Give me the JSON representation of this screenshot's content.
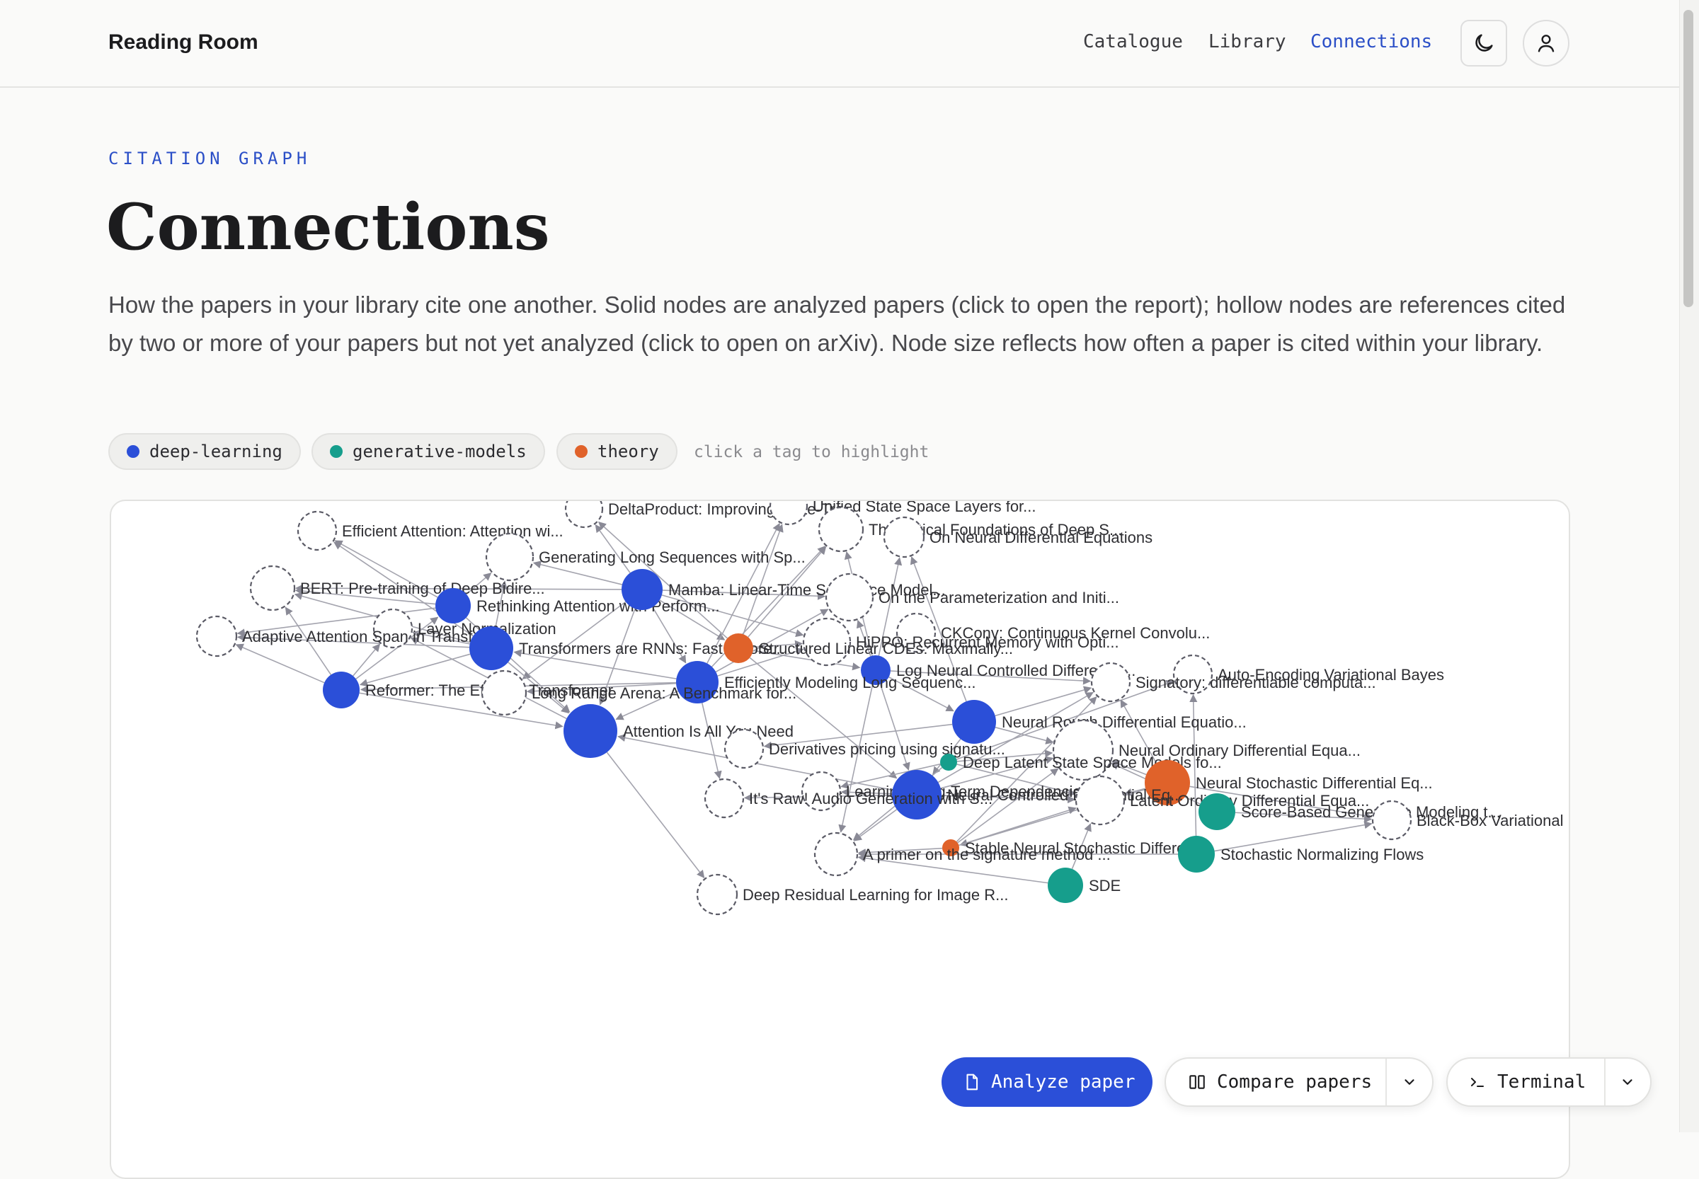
{
  "brand": "Reading Room",
  "nav": [
    {
      "label": "Catalogue",
      "active": false
    },
    {
      "label": "Library",
      "active": false
    },
    {
      "label": "Connections",
      "active": true
    }
  ],
  "header_icons": [
    "moon-icon",
    "user-icon"
  ],
  "eyebrow": "CITATION GRAPH",
  "title": "Connections",
  "description": "How the papers in your library cite one another. Solid nodes are analyzed papers (click to open the report); hollow nodes are references cited by two or more of your papers but not yet analyzed (click to open on arXiv). Node size reflects how often a paper is cited within your library.",
  "tags": [
    {
      "label": "deep-learning",
      "color": "#2b4fd8"
    },
    {
      "label": "generative-models",
      "color": "#169e8c"
    },
    {
      "label": "theory",
      "color": "#e0622a"
    }
  ],
  "tag_hint": "click a tag to highlight",
  "colors": {
    "deep-learning": "#2b4fd8",
    "generative-models": "#169e8c",
    "theory": "#e0622a",
    "accent": "#2b4fc7"
  },
  "graph": {
    "nodes": [
      {
        "id": "deltaproduct",
        "label": "DeltaProduct: Improving State-Tra...",
        "kind": "hollow"
      },
      {
        "id": "unified",
        "label": "Unified State Space Layers for...",
        "kind": "hollow"
      },
      {
        "id": "efficientattn",
        "label": "Efficient Attention: Attention wi...",
        "kind": "hollow"
      },
      {
        "id": "theofound",
        "label": "Theoretical Foundations of Deep S...",
        "kind": "hollow"
      },
      {
        "id": "neuralde",
        "label": "On Neural Differential Equations",
        "kind": "hollow"
      },
      {
        "id": "genlong",
        "label": "Generating Long Sequences with Sp...",
        "kind": "hollow"
      },
      {
        "id": "bert",
        "label": "BERT: Pre-training of Deep Bidire...",
        "kind": "hollow"
      },
      {
        "id": "rethinking",
        "label": "Rethinking Attention with Perform...",
        "kind": "deep-learning"
      },
      {
        "id": "mamba",
        "label": "Mamba: Linear-Time Sequence Model...",
        "kind": "deep-learning"
      },
      {
        "id": "param",
        "label": "On the Parameterization and Initi...",
        "kind": "hollow"
      },
      {
        "id": "layernorm",
        "label": "Layer Normalization",
        "kind": "hollow"
      },
      {
        "id": "adaptive",
        "label": "Adaptive Attention Span in Transf...",
        "kind": "hollow"
      },
      {
        "id": "ckconv",
        "label": "CKConv: Continuous Kernel Convolu...",
        "kind": "hollow"
      },
      {
        "id": "hippo",
        "label": "HiPPO: Recurrent Memory with Opti...",
        "kind": "hollow"
      },
      {
        "id": "rnns",
        "label": "Transformers are RNNs: Fast Autore...",
        "kind": "deep-learning"
      },
      {
        "id": "struct",
        "label": "Structured Linear CDEs: Maximally...",
        "kind": "theory"
      },
      {
        "id": "logncde",
        "label": "Log Neural Controlled Differentia...",
        "kind": "deep-learning"
      },
      {
        "id": "aevb",
        "label": "Auto-Encoding Variational Bayes",
        "kind": "hollow"
      },
      {
        "id": "signatory",
        "label": "Signatory: differentiable computa...",
        "kind": "hollow"
      },
      {
        "id": "reformer",
        "label": "Reformer: The Efficient Transformer",
        "kind": "deep-learning"
      },
      {
        "id": "s4",
        "label": "Efficiently Modeling Long Sequenc...",
        "kind": "deep-learning"
      },
      {
        "id": "lra",
        "label": "Long Range Arena: A Benchmark for...",
        "kind": "hollow"
      },
      {
        "id": "nrde",
        "label": "Neural Rough Differential Equatio...",
        "kind": "deep-learning"
      },
      {
        "id": "attention",
        "label": "Attention Is All You Need",
        "kind": "deep-learning"
      },
      {
        "id": "derivatives",
        "label": "Derivatives pricing using signatu...",
        "kind": "hollow"
      },
      {
        "id": "node",
        "label": "Neural Ordinary Differential Equa...",
        "kind": "hollow"
      },
      {
        "id": "deeplatent",
        "label": "Deep Latent State Space Models fo...",
        "kind": "generative-models"
      },
      {
        "id": "nsde",
        "label": "Neural Stochastic Differential Eq...",
        "kind": "theory"
      },
      {
        "id": "lstd",
        "label": "Learning Long-Term Dependencies i...",
        "kind": "hollow"
      },
      {
        "id": "ncde",
        "label": "Neural Controlled Differential Eq...",
        "kind": "deep-learning"
      },
      {
        "id": "raw",
        "label": "It's Raw! Audio Generation with S...",
        "kind": "hollow"
      },
      {
        "id": "latentode",
        "label": "Latent Ordinary Differential Equa...",
        "kind": "hollow"
      },
      {
        "id": "scorebased",
        "label": "Score-Based Generative Modeling t...",
        "kind": "generative-models"
      },
      {
        "id": "blackbox",
        "label": "Black-Box Variational Inference",
        "kind": "hollow"
      },
      {
        "id": "stablensde",
        "label": "Stable Neural Stochastic Differen...",
        "kind": "theory"
      },
      {
        "id": "primer",
        "label": "A primer on the signature method ...",
        "kind": "hollow"
      },
      {
        "id": "snf",
        "label": "Stochastic Normalizing Flows",
        "kind": "generative-models"
      },
      {
        "id": "resnet",
        "label": "Deep Residual Learning for Image R...",
        "kind": "hollow"
      },
      {
        "id": "sde",
        "label": "SDE",
        "kind": "generative-models"
      }
    ],
    "edges": [
      [
        "rethinking",
        "efficientattn"
      ],
      [
        "rethinking",
        "bert"
      ],
      [
        "rethinking",
        "genlong"
      ],
      [
        "rethinking",
        "attention"
      ],
      [
        "rethinking",
        "adaptive"
      ],
      [
        "mamba",
        "genlong"
      ],
      [
        "mamba",
        "bert"
      ],
      [
        "mamba",
        "s4"
      ],
      [
        "mamba",
        "attention"
      ],
      [
        "mamba",
        "param"
      ],
      [
        "mamba",
        "deltaproduct"
      ],
      [
        "mamba",
        "struct"
      ],
      [
        "mamba",
        "lra"
      ],
      [
        "mamba",
        "hippo"
      ],
      [
        "rnns",
        "efficientattn"
      ],
      [
        "rnns",
        "bert"
      ],
      [
        "rnns",
        "adaptive"
      ],
      [
        "rnns",
        "layernorm"
      ],
      [
        "rnns",
        "attention"
      ],
      [
        "rnns",
        "genlong"
      ],
      [
        "rnns",
        "reformer"
      ],
      [
        "reformer",
        "adaptive"
      ],
      [
        "reformer",
        "bert"
      ],
      [
        "reformer",
        "attention"
      ],
      [
        "reformer",
        "layernorm"
      ],
      [
        "reformer",
        "rethinking"
      ],
      [
        "s4",
        "hippo"
      ],
      [
        "s4",
        "lra"
      ],
      [
        "s4",
        "attention"
      ],
      [
        "s4",
        "rnns"
      ],
      [
        "s4",
        "reformer"
      ],
      [
        "s4",
        "param"
      ],
      [
        "s4",
        "unified"
      ],
      [
        "s4",
        "theofound"
      ],
      [
        "s4",
        "raw"
      ],
      [
        "struct",
        "deltaproduct"
      ],
      [
        "struct",
        "unified"
      ],
      [
        "struct",
        "theofound"
      ],
      [
        "struct",
        "logncde"
      ],
      [
        "struct",
        "ncde"
      ],
      [
        "struct",
        "hippo"
      ],
      [
        "logncde",
        "neuralde"
      ],
      [
        "logncde",
        "signatory"
      ],
      [
        "logncde",
        "nrde"
      ],
      [
        "logncde",
        "ncde"
      ],
      [
        "logncde",
        "primer"
      ],
      [
        "logncde",
        "theofound"
      ],
      [
        "logncde",
        "param"
      ],
      [
        "nrde",
        "signatory"
      ],
      [
        "nrde",
        "node"
      ],
      [
        "nrde",
        "ncde"
      ],
      [
        "nrde",
        "derivatives"
      ],
      [
        "nrde",
        "neuralde"
      ],
      [
        "ncde",
        "node"
      ],
      [
        "ncde",
        "lstd"
      ],
      [
        "ncde",
        "raw"
      ],
      [
        "ncde",
        "primer"
      ],
      [
        "ncde",
        "signatory"
      ],
      [
        "ncde",
        "latentode"
      ],
      [
        "ncde",
        "attention"
      ],
      [
        "deeplatent",
        "node"
      ],
      [
        "deeplatent",
        "aevb"
      ],
      [
        "deeplatent",
        "lstd"
      ],
      [
        "deeplatent",
        "latentode"
      ],
      [
        "deeplatent",
        "primer"
      ],
      [
        "nsde",
        "node"
      ],
      [
        "nsde",
        "latentode"
      ],
      [
        "nsde",
        "stablensde"
      ],
      [
        "nsde",
        "blackbox"
      ],
      [
        "nsde",
        "signatory"
      ],
      [
        "stablensde",
        "node"
      ],
      [
        "stablensde",
        "latentode"
      ],
      [
        "stablensde",
        "primer"
      ],
      [
        "stablensde",
        "signatory"
      ],
      [
        "snf",
        "aevb"
      ],
      [
        "snf",
        "blackbox"
      ],
      [
        "snf",
        "primer"
      ],
      [
        "scorebased",
        "node"
      ],
      [
        "scorebased",
        "blackbox"
      ],
      [
        "attention",
        "resnet"
      ],
      [
        "attention",
        "layernorm"
      ],
      [
        "sde",
        "latentode"
      ],
      [
        "sde",
        "primer"
      ]
    ]
  }
}
